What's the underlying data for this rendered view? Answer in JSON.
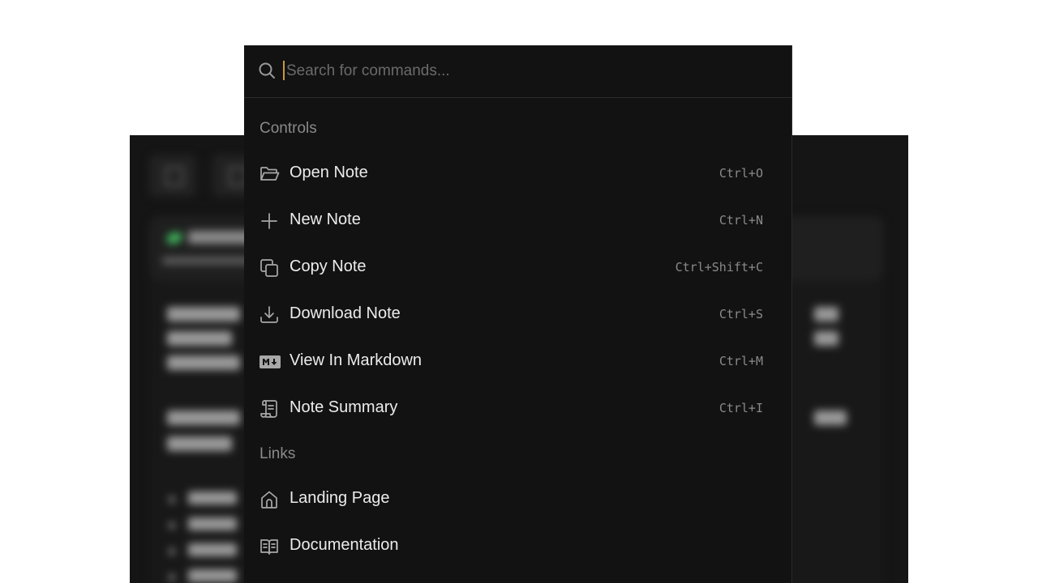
{
  "search": {
    "placeholder": "Search for commands..."
  },
  "sections": {
    "controls": "Controls",
    "links": "Links"
  },
  "commands": [
    {
      "label": "Open Note",
      "shortcut": "Ctrl+O",
      "icon": "folder-open-icon"
    },
    {
      "label": "New Note",
      "shortcut": "Ctrl+N",
      "icon": "plus-icon"
    },
    {
      "label": "Copy Note",
      "shortcut": "Ctrl+Shift+C",
      "icon": "copy-icon"
    },
    {
      "label": "Download Note",
      "shortcut": "Ctrl+S",
      "icon": "download-icon"
    },
    {
      "label": "View In Markdown",
      "shortcut": "Ctrl+M",
      "icon": "markdown-icon"
    },
    {
      "label": "Note Summary",
      "shortcut": "Ctrl+I",
      "icon": "scroll-icon"
    }
  ],
  "links": [
    {
      "label": "Landing Page",
      "icon": "home-icon"
    },
    {
      "label": "Documentation",
      "icon": "book-open-icon"
    }
  ],
  "colors": {
    "palette_bg": "#121212",
    "text": "#ececec",
    "muted": "#8a8a8a",
    "caret": "#c79a3a",
    "background_app": "#151515"
  }
}
